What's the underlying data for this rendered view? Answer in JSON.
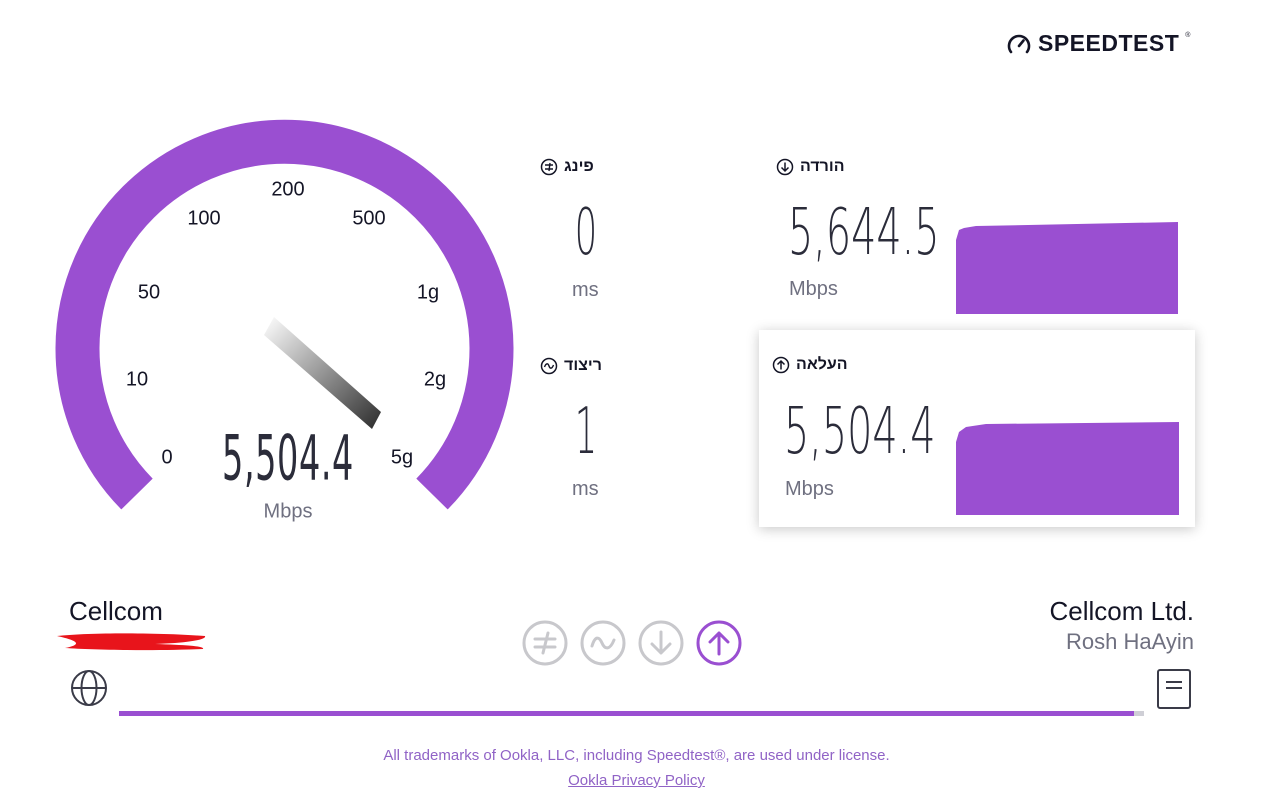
{
  "brand": {
    "logo_text": "SPEEDTEST",
    "logo_tm": "®",
    "accent": "#9a4fd1"
  },
  "gauge": {
    "ticks": [
      "0",
      "10",
      "50",
      "100",
      "200",
      "500",
      "1g",
      "2g",
      "5g"
    ],
    "value": "5,504.4",
    "unit": "Mbps"
  },
  "ping": {
    "label": "פינג",
    "value": "0",
    "unit": "ms"
  },
  "jitter": {
    "label": "ריצוד",
    "value": "1",
    "unit": "ms"
  },
  "download": {
    "label": "הורדה",
    "value": "5,644.5",
    "unit": "Mbps"
  },
  "upload": {
    "label": "העלאה",
    "value": "5,504.4",
    "unit": "Mbps"
  },
  "connection": {
    "client_isp": "Cellcom",
    "server_name": "Cellcom Ltd.",
    "server_location": "Rosh HaAyin"
  },
  "steps": [
    {
      "name": "ping",
      "icon": "ping-icon",
      "active": false
    },
    {
      "name": "jitter",
      "icon": "jitter-icon",
      "active": false
    },
    {
      "name": "download",
      "icon": "download-icon",
      "active": false
    },
    {
      "name": "upload",
      "icon": "upload-icon",
      "active": true
    }
  ],
  "progress": 0.99,
  "footer": {
    "trademark": "All trademarks of Ookla, LLC, including Speedtest®, are used under license.",
    "privacy_link": "Ookla Privacy Policy"
  }
}
